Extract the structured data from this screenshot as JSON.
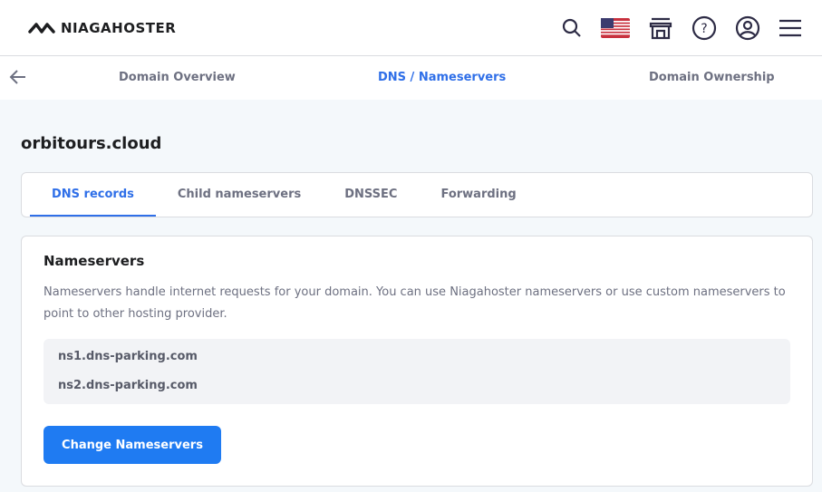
{
  "header": {
    "brand": "NIAGAHOSTER"
  },
  "subnav": {
    "items": [
      "Domain Overview",
      "DNS / Nameservers",
      "Domain Ownership"
    ]
  },
  "domain": "orbitours.cloud",
  "tabs": [
    "DNS records",
    "Child nameservers",
    "DNSSEC",
    "Forwarding"
  ],
  "card": {
    "title": "Nameservers",
    "description": "Nameservers handle internet requests for your domain. You can use Niagahoster nameservers or use custom nameservers to point to other hosting provider.",
    "nameservers": [
      "ns1.dns-parking.com",
      "ns2.dns-parking.com"
    ],
    "button": "Change Nameservers"
  },
  "colors": {
    "accent": "#2f6fe8",
    "button": "#1f7bf2"
  }
}
